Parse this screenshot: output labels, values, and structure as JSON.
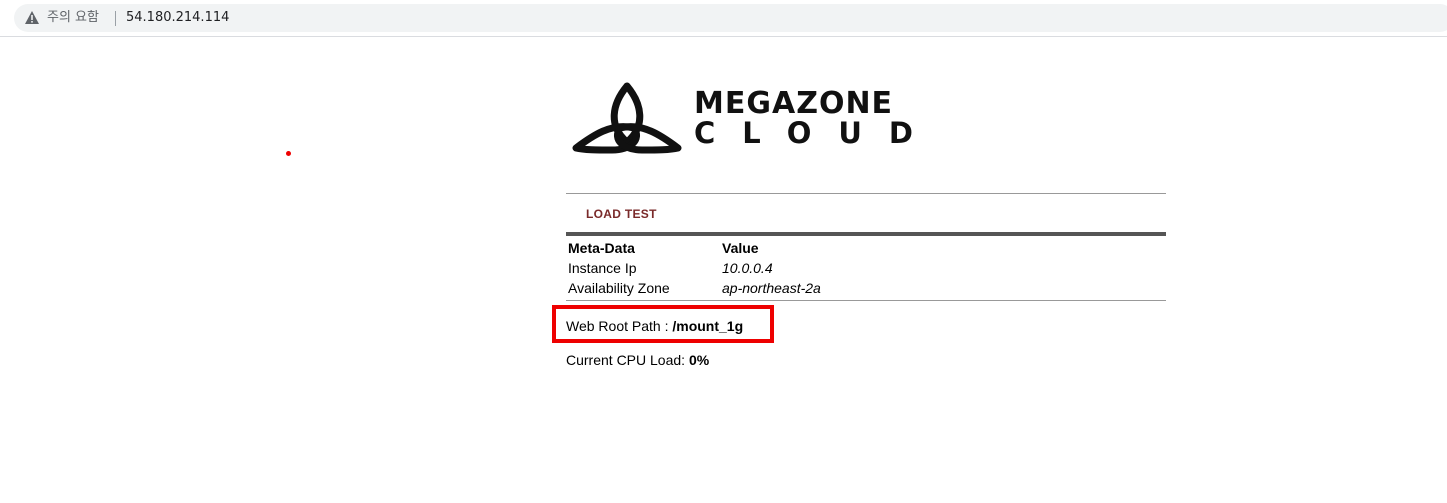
{
  "browser": {
    "security_label": "주의 요함",
    "url": "54.180.214.114",
    "warning_icon": "warning-triangle-icon"
  },
  "logo": {
    "line1": "MEGAZONE",
    "line2": "CLOUD"
  },
  "section": {
    "title": "LOAD TEST"
  },
  "meta_table": {
    "headers": [
      "Meta-Data",
      "Value"
    ],
    "rows": [
      [
        "Instance Ip",
        "10.0.0.4"
      ],
      [
        "Availability Zone",
        "ap-northeast-2a"
      ]
    ]
  },
  "web_root": {
    "label": "Web Root Path : ",
    "value": "/mount_1g"
  },
  "cpu": {
    "label": "Current CPU Load: ",
    "value": "0%"
  },
  "colors": {
    "highlight": "#ee0000",
    "section_title": "#7a2a2a"
  }
}
